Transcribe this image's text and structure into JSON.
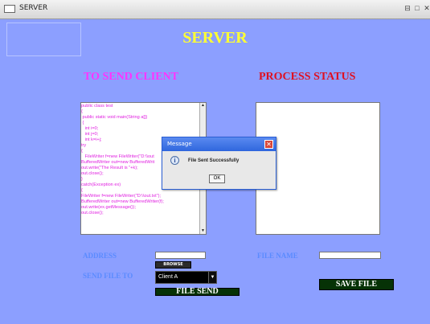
{
  "window": {
    "title": "SERVER",
    "controls": {
      "restore": "⊟",
      "maximize": "□",
      "close": "✕"
    }
  },
  "main": {
    "title": "SERVER",
    "left_heading": "TO SEND CLIENT",
    "right_heading": "PROCESS STATUS",
    "code_lines": [
      "public class test",
      "{",
      " public static void main(String a[])",
      " {",
      "   int i=0;",
      "   int j=0;",
      "   int k=i+j;",
      "try",
      "{",
      "   FileWriter f=new FileWriter(\"D:\\\\out",
      "BufferedWriter out=new BufferedWrit",
      "out.write(\"The Result is \"+k);",
      "out.close();",
      "}",
      "catch(Exception ex)",
      "{",
      "FileWriter f=new FileWriter(\"D:\\\\out.txt\");",
      "BufferedWriter out=new BufferedWriter(f);",
      "out.write(ex.getMessage());",
      "out.close();"
    ],
    "address_label": "ADDRESS",
    "file_name_label": "FILE NAME",
    "send_file_to_label": "SEND FILE TO",
    "browse_label": "BROWSE",
    "client_selected": "Client A",
    "file_send_label": "FILE  SEND",
    "save_file_label": "SAVE FILE",
    "address_value": "",
    "file_name_value": ""
  },
  "dialog": {
    "title": "Message",
    "message": "File Sent Successfully",
    "ok_label": "OK"
  },
  "colors": {
    "background": "#8c9fff",
    "title": "#ffff33",
    "left_heading": "#ff33ff",
    "right_heading": "#e0101f",
    "code_text": "#e020e0",
    "field_label": "#5b8bff",
    "button_green": "#063206"
  }
}
